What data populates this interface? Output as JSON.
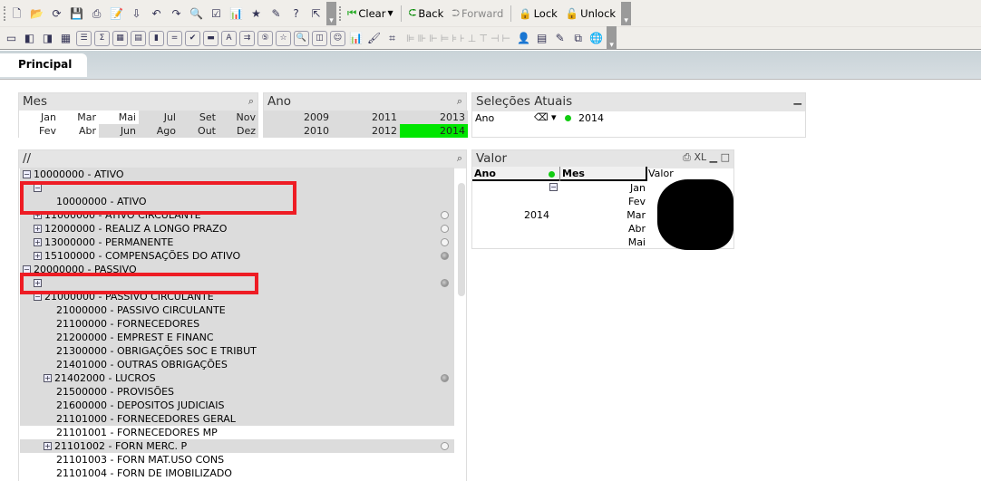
{
  "toolbar1": {
    "icons": [
      "new-doc-icon",
      "open-folder-icon",
      "reload-icon",
      "save-icon",
      "print-icon",
      "edit-script-icon",
      "reload-data-icon",
      "undo-icon",
      "redo-icon",
      "search-icon",
      "selection-checkbox-icon",
      "chart-wizard-icon",
      "bookmark-star-icon",
      "edit-icon",
      "help-icon",
      "whats-this-icon"
    ],
    "clear": "Clear",
    "back": "Back",
    "forward": "Forward",
    "lock": "Lock",
    "unlock": "Unlock"
  },
  "toolbar2": {
    "icons": [
      "new-sheet-icon",
      "move-left-icon",
      "move-right-icon",
      "sheet-properties-icon",
      "listbox-icon",
      "statistics-box-icon",
      "table-box-icon",
      "multibox-icon",
      "chart-icon",
      "input-box-icon",
      "current-selections-icon",
      "button-icon",
      "text-object-icon",
      "line-arrow-icon",
      "slider-icon",
      "bookmark-object-icon",
      "search-object-icon",
      "container-icon",
      "custom-object-icon",
      "chart-wizard-icon",
      "format-painter-icon",
      "grid-icon"
    ]
  },
  "tabs": [
    {
      "label": "Principal",
      "active": true
    }
  ],
  "mes": {
    "title": "Mes",
    "items": [
      {
        "label": "Jan",
        "state": "possible"
      },
      {
        "label": "Fev",
        "state": "possible"
      },
      {
        "label": "Mar",
        "state": "possible"
      },
      {
        "label": "Abr",
        "state": "possible"
      },
      {
        "label": "Mai",
        "state": "possible"
      },
      {
        "label": "Jun",
        "state": "excluded"
      },
      {
        "label": "Jul",
        "state": "excluded"
      },
      {
        "label": "Ago",
        "state": "excluded"
      },
      {
        "label": "Set",
        "state": "excluded"
      },
      {
        "label": "Out",
        "state": "excluded"
      },
      {
        "label": "Nov",
        "state": "excluded"
      },
      {
        "label": "Dez",
        "state": "excluded"
      }
    ]
  },
  "ano": {
    "title": "Ano",
    "items": [
      {
        "label": "2009",
        "state": "excluded"
      },
      {
        "label": "2010",
        "state": "excluded"
      },
      {
        "label": "2011",
        "state": "excluded"
      },
      {
        "label": "2012",
        "state": "excluded"
      },
      {
        "label": "2013",
        "state": "excluded"
      },
      {
        "label": "2014",
        "state": "selected"
      }
    ]
  },
  "selecoes": {
    "title": "Seleções Atuais",
    "field": "Ano",
    "value": "2014"
  },
  "tree": {
    "title": "//",
    "rows": [
      {
        "level": 0,
        "exp": "−",
        "text": "10000000 - ATIVO",
        "ind": "",
        "bg": "g"
      },
      {
        "level": 1,
        "exp": "−",
        "text": "",
        "ind": "",
        "bg": "g"
      },
      {
        "level": 2,
        "exp": "",
        "text": "10000000 - ATIVO",
        "ind": "",
        "bg": "g"
      },
      {
        "level": 1,
        "exp": "+",
        "text": "11000000 - ATIVO CIRCULANTE",
        "ind": "empty",
        "bg": "g"
      },
      {
        "level": 1,
        "exp": "+",
        "text": "12000000 - REALIZ  A LONGO PRAZO",
        "ind": "empty",
        "bg": "g"
      },
      {
        "level": 1,
        "exp": "+",
        "text": "13000000 - PERMANENTE",
        "ind": "empty",
        "bg": "g"
      },
      {
        "level": 1,
        "exp": "+",
        "text": "15100000 - COMPENSAÇÕES DO ATIVO",
        "ind": "gray",
        "bg": "g"
      },
      {
        "level": 0,
        "exp": "−",
        "text": "20000000 - PASSIVO",
        "ind": "",
        "bg": "g"
      },
      {
        "level": 1,
        "exp": "+",
        "text": "",
        "ind": "gray",
        "bg": "g"
      },
      {
        "level": 1,
        "exp": "−",
        "text": "21000000 - PASSIVO CIRCULANTE",
        "ind": "",
        "bg": "g"
      },
      {
        "level": 2,
        "exp": "",
        "text": "21000000 - PASSIVO CIRCULANTE",
        "ind": "",
        "bg": "g"
      },
      {
        "level": 2,
        "exp": "",
        "text": "21100000 - FORNECEDORES",
        "ind": "",
        "bg": "g"
      },
      {
        "level": 2,
        "exp": "",
        "text": "21200000 - EMPREST E FINANC",
        "ind": "",
        "bg": "g"
      },
      {
        "level": 2,
        "exp": "",
        "text": "21300000 - OBRIGAÇÕES SOC E TRIBUT",
        "ind": "",
        "bg": "g"
      },
      {
        "level": 2,
        "exp": "",
        "text": "21401000 - OUTRAS OBRIGAÇÕES",
        "ind": "",
        "bg": "g"
      },
      {
        "level": 3,
        "exp": "+",
        "text": "21402000 - LUCROS",
        "ind": "gray",
        "bg": "g"
      },
      {
        "level": 2,
        "exp": "",
        "text": "21500000 - PROVISÕES",
        "ind": "",
        "bg": "g"
      },
      {
        "level": 2,
        "exp": "",
        "text": "21600000 - DEPOSITOS  JUDICIAIS",
        "ind": "",
        "bg": "g"
      },
      {
        "level": 2,
        "exp": "",
        "text": "21101000 - FORNECEDORES GERAL",
        "ind": "",
        "bg": "g"
      },
      {
        "level": 2,
        "exp": "",
        "text": "21101001 - FORNECEDORES MP",
        "ind": "",
        "bg": "w"
      },
      {
        "level": 3,
        "exp": "+",
        "text": "21101002 - FORN MERC. P",
        "ind": "empty",
        "bg": "g"
      },
      {
        "level": 2,
        "exp": "",
        "text": "21101003 - FORN MAT.USO CONS",
        "ind": "",
        "bg": "w"
      },
      {
        "level": 2,
        "exp": "",
        "text": "21101004 - FORN DE IMOBILIZADO",
        "ind": "",
        "bg": "w"
      }
    ]
  },
  "valor": {
    "title": "Valor",
    "xl": "XL",
    "headers": [
      "Ano",
      "Mes",
      "Valor"
    ],
    "ano": "2014",
    "meses": [
      "Jan",
      "Fev",
      "Mar",
      "Abr",
      "Mai"
    ]
  }
}
